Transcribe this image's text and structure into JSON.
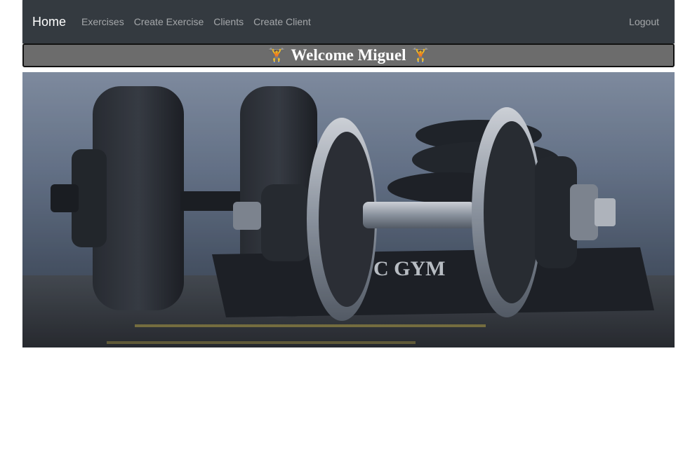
{
  "navbar": {
    "brand": "Home",
    "links": [
      "Exercises",
      "Create Exercise",
      "Clients",
      "Create Client"
    ],
    "logout": "Logout"
  },
  "welcome": {
    "emoji_left": "🏋",
    "text": "Welcome Miguel",
    "emoji_right": "🏋"
  },
  "hero": {
    "image_text": "C GYM"
  },
  "colors": {
    "navbar_bg": "#343a40",
    "welcome_bg": "#6c6c6c"
  }
}
